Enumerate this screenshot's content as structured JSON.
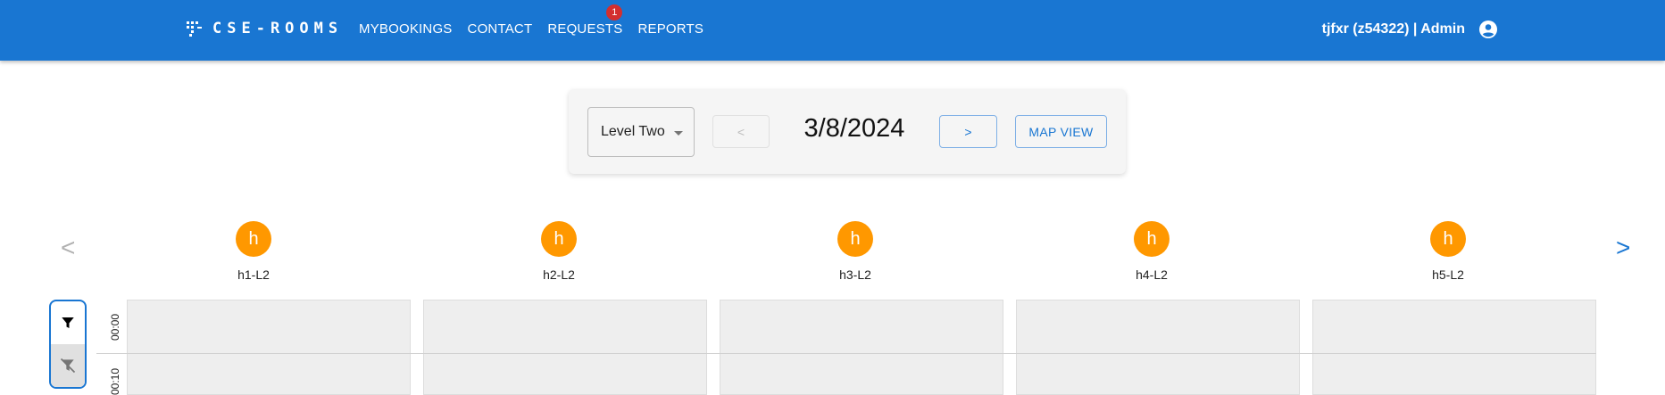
{
  "header": {
    "logo_text": "CSE-ROOMS",
    "nav": [
      {
        "label": "MYBOOKINGS"
      },
      {
        "label": "CONTACT"
      },
      {
        "label": "REQUESTS",
        "badge": "1"
      },
      {
        "label": "REPORTS"
      }
    ],
    "user_label": "tjfxr (z54322) | Admin",
    "user_icon": "account-circle-icon",
    "colors": {
      "bar": "#1976d2",
      "badge": "#d32f2f"
    }
  },
  "controls": {
    "level_select": "Level Two",
    "prev_label": "<",
    "date": "3/8/2024",
    "next_label": ">",
    "map_view_label": "MAP VIEW"
  },
  "rooms": {
    "prev_arrow": "<",
    "next_arrow": ">",
    "items": [
      {
        "avatar": "h",
        "name": "h1-L2"
      },
      {
        "avatar": "h",
        "name": "h2-L2"
      },
      {
        "avatar": "h",
        "name": "h3-L2"
      },
      {
        "avatar": "h",
        "name": "h4-L2"
      },
      {
        "avatar": "h",
        "name": "h5-L2"
      }
    ],
    "avatar_color": "#ff9800"
  },
  "filters": {
    "filter_icon": "filter-icon",
    "clear_filter_icon": "filter-off-icon"
  },
  "timeline": {
    "times": [
      "00:00",
      "00:10"
    ]
  }
}
